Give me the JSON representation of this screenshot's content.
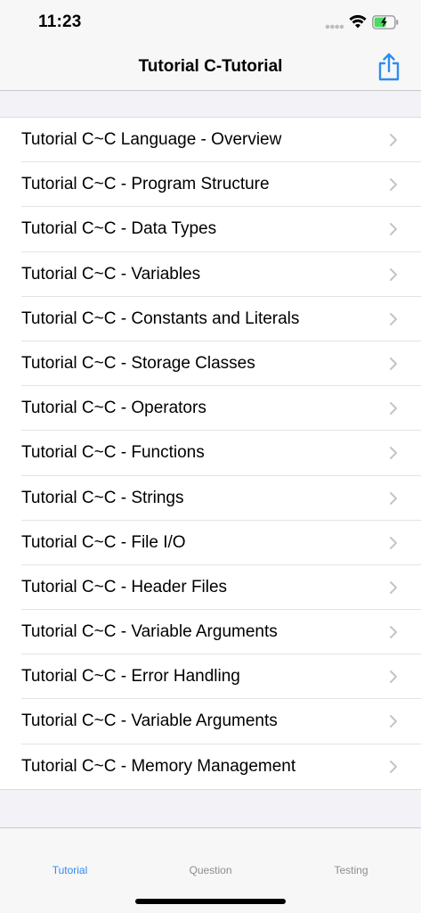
{
  "status_bar": {
    "time": "11:23"
  },
  "nav": {
    "title": "Tutorial C-Tutorial",
    "share_icon": "share-icon"
  },
  "list": {
    "items": [
      {
        "label": "Tutorial C~C Language - Overview"
      },
      {
        "label": "Tutorial C~C - Program Structure"
      },
      {
        "label": "Tutorial C~C - Data Types"
      },
      {
        "label": "Tutorial C~C - Variables"
      },
      {
        "label": "Tutorial C~C - Constants and Literals"
      },
      {
        "label": "Tutorial C~C - Storage Classes"
      },
      {
        "label": "Tutorial C~C - Operators"
      },
      {
        "label": "Tutorial C~C - Functions"
      },
      {
        "label": "Tutorial C~C - Strings"
      },
      {
        "label": "Tutorial C~C - File I/O"
      },
      {
        "label": "Tutorial C~C - Header Files"
      },
      {
        "label": "Tutorial C~C - Variable Arguments"
      },
      {
        "label": "Tutorial C~C - Error Handling"
      },
      {
        "label": "Tutorial C~C - Variable Arguments"
      },
      {
        "label": "Tutorial C~C - Memory Management"
      }
    ]
  },
  "tabs": {
    "tutorial": "Tutorial",
    "question": "Question",
    "testing": "Testing",
    "active": "Tutorial"
  },
  "colors": {
    "accent": "#2f8cf0",
    "inactive_tab": "#8e8e93",
    "battery_fill": "#4cd964"
  }
}
